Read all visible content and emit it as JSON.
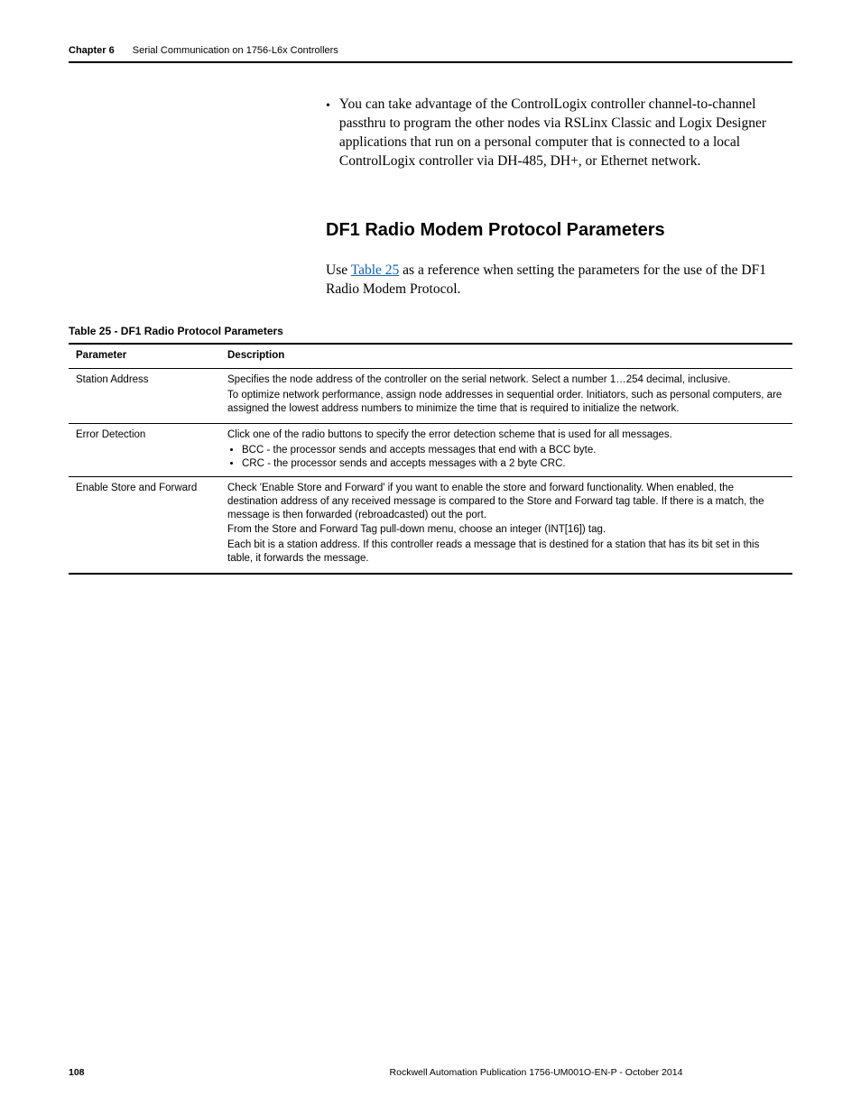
{
  "header": {
    "chapter_label": "Chapter 6",
    "chapter_title": "Serial Communication on 1756-L6x Controllers"
  },
  "intro_bullet": "You can take advantage of the ControlLogix controller channel-to-channel passthru to program the other nodes via RSLinx Classic and Logix Designer applications that run on a personal computer that is connected to a local ControlLogix controller via DH-485, DH+, or Ethernet network.",
  "section": {
    "heading": "DF1 Radio Modem Protocol Parameters",
    "intro_prefix": "Use ",
    "intro_link": "Table 25",
    "intro_suffix": " as a reference when setting the parameters for the use of the DF1 Radio Modem Protocol."
  },
  "table": {
    "caption": "Table 25 - DF1 Radio Protocol Parameters",
    "head": {
      "param": "Parameter",
      "desc": "Description"
    },
    "rows": [
      {
        "param": "Station Address",
        "desc": [
          "Specifies the node address of the controller on the serial network. Select a number 1…254 decimal, inclusive.",
          "To optimize network performance, assign node addresses in sequential order. Initiators, such as personal computers, are assigned the lowest address numbers to minimize the time that is required to initialize the network."
        ]
      },
      {
        "param": "Error Detection",
        "desc_lead": "Click one of the radio buttons to specify the error detection scheme that is used for all messages.",
        "desc_bullets": [
          "BCC - the processor sends and accepts messages that end with a BCC byte.",
          "CRC - the processor sends and accepts messages with a 2 byte CRC."
        ]
      },
      {
        "param": "Enable Store and Forward",
        "desc": [
          "Check 'Enable Store and Forward' if you want to enable the store and forward functionality.   When enabled, the destination address of any received message is compared to the Store and Forward tag table. If there is a match, the message is then forwarded (rebroadcasted) out the port.",
          "From the Store and Forward Tag pull-down menu, choose an integer (INT[16]) tag.",
          "Each bit is a station address. If this controller reads a message that is destined for a station that has its bit set in this table, it forwards the message."
        ]
      }
    ]
  },
  "footer": {
    "page_number": "108",
    "publication": "Rockwell Automation Publication 1756-UM001O-EN-P - October 2014"
  }
}
